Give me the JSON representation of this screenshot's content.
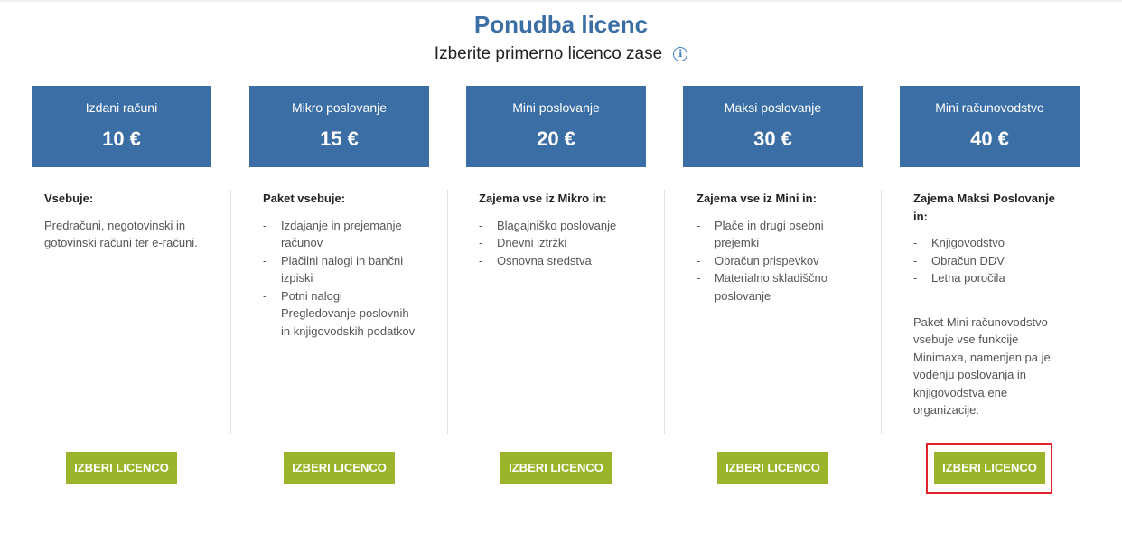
{
  "page": {
    "title": "Ponudba licenc",
    "subtitle": "Izberite primerno licenco zase",
    "info_icon": "i"
  },
  "plans": [
    {
      "name": "Izdani računi",
      "price": "10 €",
      "heading": "Vsebuje:",
      "text": "Predračuni, negotovinski in gotovinski računi ter e-računi.",
      "button": "IZBERI LICENCO"
    },
    {
      "name": "Mikro poslovanje",
      "price": "15 €",
      "heading": "Paket vsebuje:",
      "items": [
        "Izdajanje in prejemanje računov",
        "Plačilni nalogi in bančni izpiski",
        "Potni nalogi",
        "Pregledovanje poslovnih in knjigovodskih podatkov"
      ],
      "button": "IZBERI LICENCO"
    },
    {
      "name": "Mini poslovanje",
      "price": "20 €",
      "heading": "Zajema vse iz Mikro in:",
      "items": [
        "Blagajniško poslovanje",
        "Dnevni iztržki",
        "Osnovna sredstva"
      ],
      "button": "IZBERI LICENCO"
    },
    {
      "name": "Maksi poslovanje",
      "price": "30 €",
      "heading": "Zajema vse iz Mini in:",
      "items": [
        "Plače in drugi osebni prejemki",
        "Obračun prispevkov",
        "Materialno skladiščno poslovanje"
      ],
      "button": "IZBERI LICENCO"
    },
    {
      "name": "Mini računovodstvo",
      "price": "40 €",
      "heading": "Zajema Maksi Poslovanje in:",
      "items": [
        "Knjigovodstvo",
        "Obračun DDV",
        "Letna poročila"
      ],
      "note": "Paket Mini računovodstvo vsebuje vse funkcije Minimaxa, namenjen pa je vodenju poslovanja in knjigovodstva ene organizacije.",
      "button": "IZBERI LICENCO",
      "selected": true
    }
  ],
  "colors": {
    "header_bg": "#3a6ea5",
    "title": "#3a6ea5",
    "button_bg": "#9ab52c",
    "highlight": "#e0242c"
  }
}
